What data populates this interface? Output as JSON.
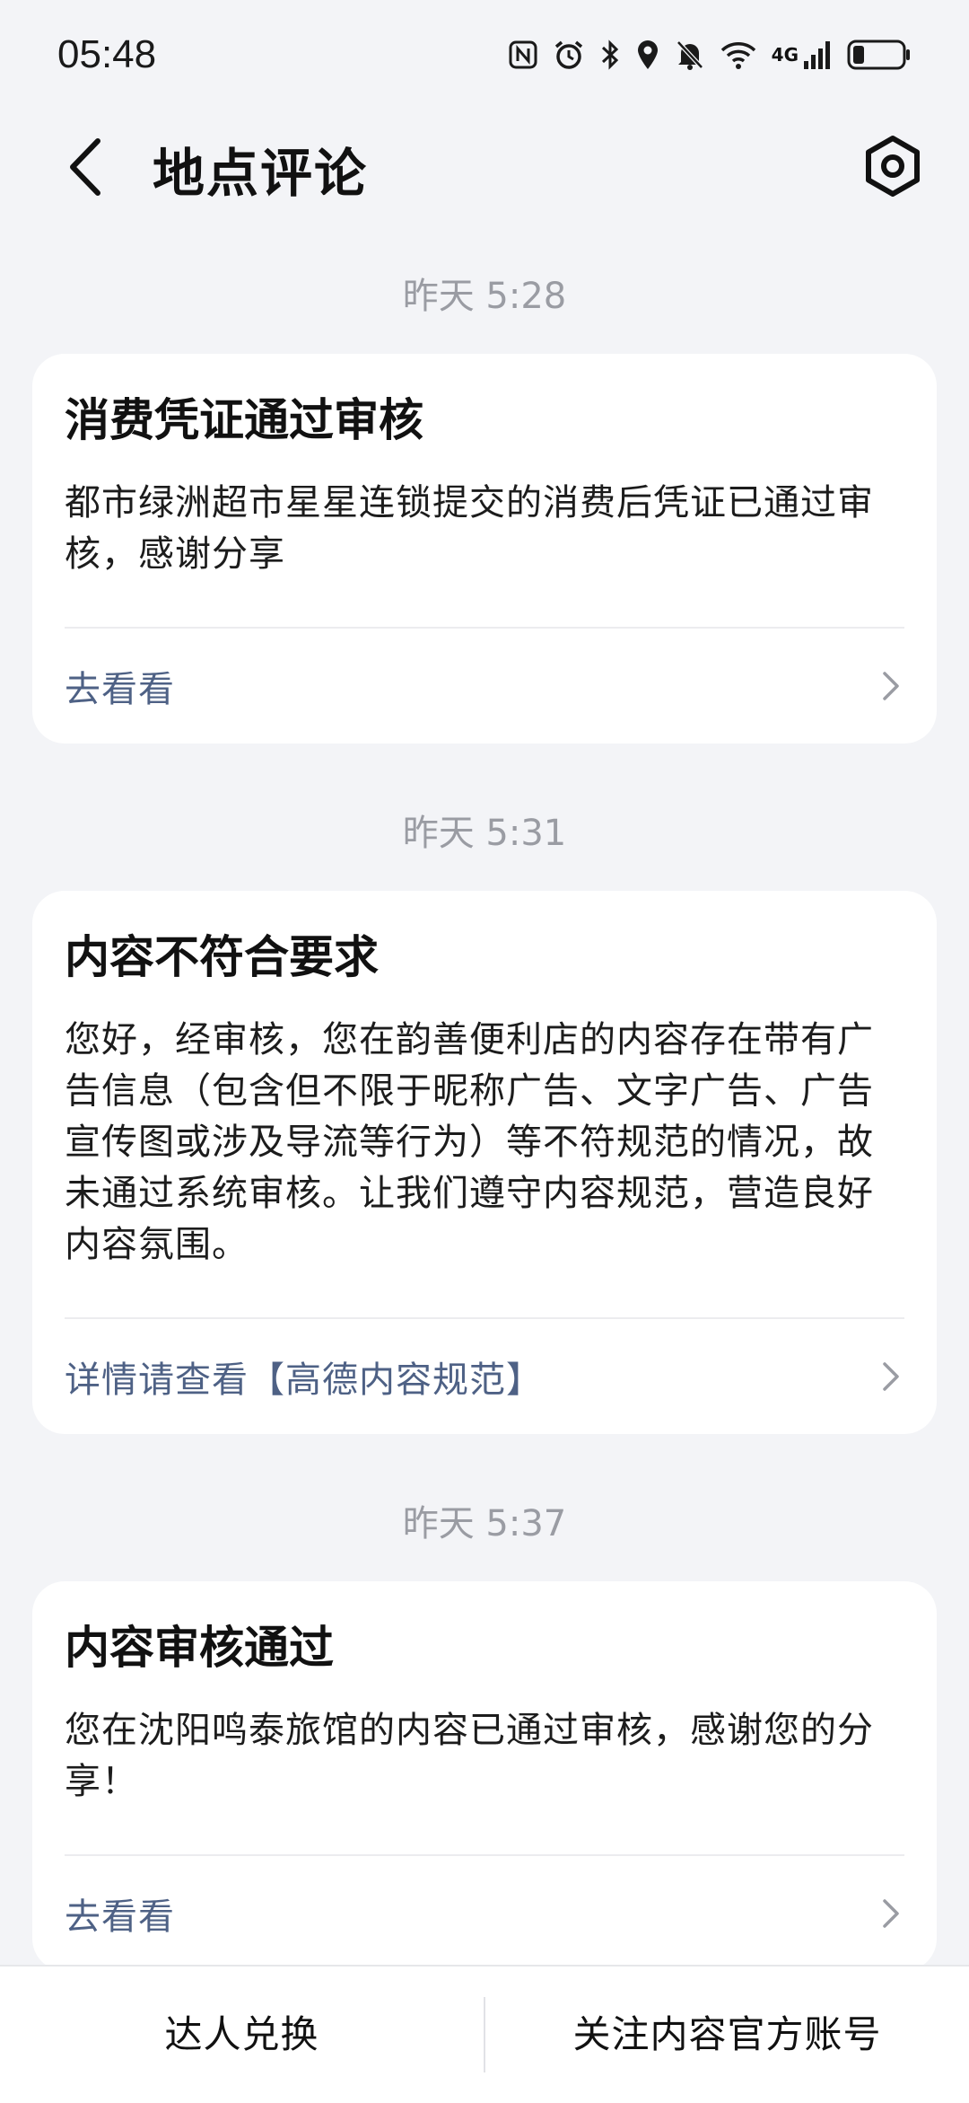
{
  "status_bar": {
    "time": "05:48",
    "network_label": "4G",
    "icons": [
      "nfc-icon",
      "alarm-icon",
      "bluetooth-icon",
      "location-icon",
      "mute-icon",
      "wifi-icon",
      "cellular-signal-icon",
      "battery-icon"
    ]
  },
  "header": {
    "title": "地点评论",
    "back_icon": "chevron-left-icon",
    "settings_icon": "settings-hexagon-icon"
  },
  "messages": [
    {
      "time": "昨天 5:28",
      "title": "消费凭证通过审核",
      "body": "都市绿洲超市星星连锁提交的消费后凭证已通过审核，感谢分享",
      "link": "去看看"
    },
    {
      "time": "昨天 5:31",
      "title": "内容不符合要求",
      "body": "您好，经审核，您在韵善便利店的内容存在带有广告信息（包含但不限于昵称广告、文字广告、广告宣传图或涉及导流等行为）等不符规范的情况，故未通过系统审核。让我们遵守内容规范，营造良好内容氛围。",
      "link": "详情请查看【高德内容规范】"
    },
    {
      "time": "昨天 5:37",
      "title": "内容审核通过",
      "body": "您在沈阳鸣泰旅馆的内容已通过审核，感谢您的分享！",
      "link": "去看看"
    }
  ],
  "bottom_bar": {
    "left": "达人兑换",
    "right": "关注内容官方账号"
  },
  "colors": {
    "background": "#f3f4f7",
    "card": "#ffffff",
    "link": "#4e6185",
    "timestamp": "#9a9ca3"
  }
}
